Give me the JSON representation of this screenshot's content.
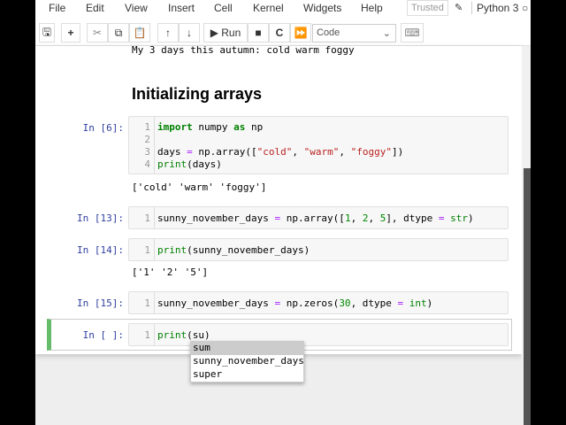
{
  "menu": {
    "items": [
      "File",
      "Edit",
      "View",
      "Insert",
      "Cell",
      "Kernel",
      "Widgets",
      "Help"
    ],
    "trusted": "Trusted",
    "kernel": "Python 3"
  },
  "toolbar": {
    "run_label": "Run",
    "cell_type": "Code"
  },
  "notebook": {
    "prev_output": "My 3 days this autumn: cold warm foggy",
    "heading": "Initializing arrays",
    "cells": [
      {
        "prompt": "In [6]:",
        "lines": [
          {
            "n": "1",
            "code": "import numpy as np"
          },
          {
            "n": "2",
            "code": ""
          },
          {
            "n": "3",
            "code": "days = np.array([\"cold\", \"warm\", \"foggy\"])"
          },
          {
            "n": "4",
            "code": "print(days)"
          }
        ],
        "output": "['cold' 'warm' 'foggy']"
      },
      {
        "prompt": "In [13]:",
        "lines": [
          {
            "n": "1",
            "code": "sunny_november_days = np.array([1, 2, 5], dtype = str)"
          }
        ]
      },
      {
        "prompt": "In [14]:",
        "lines": [
          {
            "n": "1",
            "code": "print(sunny_november_days)"
          }
        ],
        "output": "['1' '2' '5']"
      },
      {
        "prompt": "In [15]:",
        "lines": [
          {
            "n": "1",
            "code": "sunny_november_days = np.zeros(30, dtype = int)"
          }
        ]
      },
      {
        "prompt": "In [ ]:",
        "lines": [
          {
            "n": "1",
            "code": "print(su)"
          }
        ]
      }
    ]
  },
  "autocomplete": {
    "options": [
      "sum",
      "sunny_november_days",
      "super"
    ],
    "selected": "sum"
  },
  "colors": {
    "selected_cell": "#66bb6a",
    "prompt": "#303f9f"
  }
}
